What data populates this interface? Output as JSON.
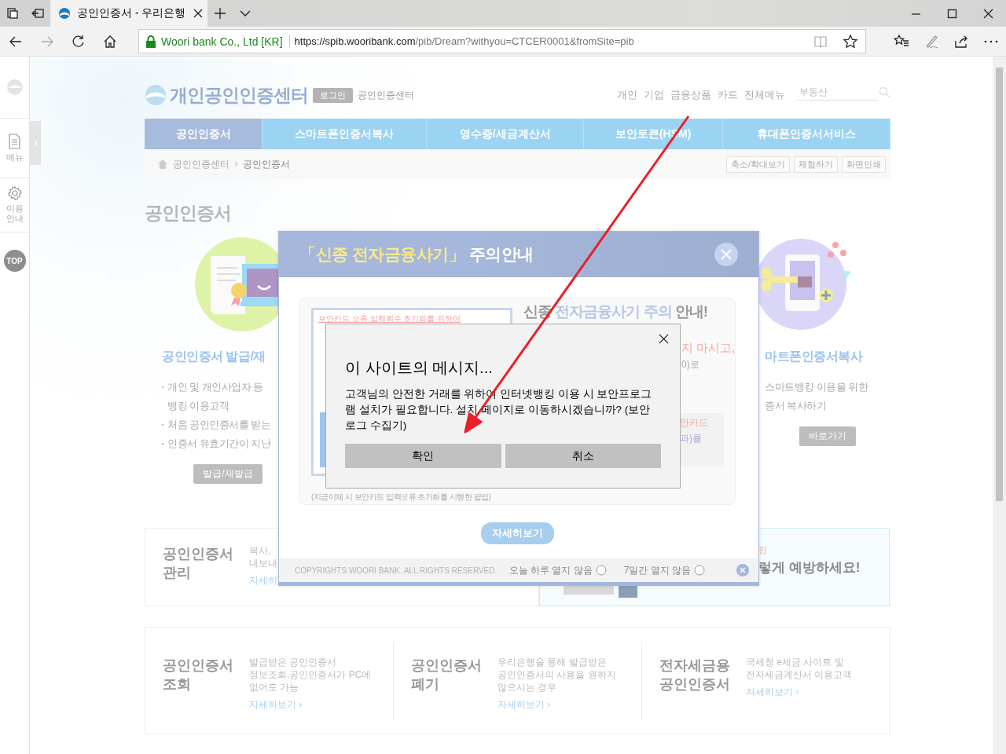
{
  "browser": {
    "tabs": [
      {
        "title": "공인인증서 - 우리은행",
        "selected": true
      }
    ],
    "site_identity": "Woori bank Co., Ltd [KR]",
    "url": {
      "host": "https://spib.wooribank.com",
      "path": "/pib/Dream?withyou=CTCER0001&fromSite=pib"
    }
  },
  "sidebar": {
    "items": [
      {
        "label": "메뉴",
        "kind": "document"
      },
      {
        "label": "이용\n안내",
        "kind": "gear"
      }
    ],
    "top_button": "TOP"
  },
  "header": {
    "logo": "개인공인인증센터",
    "login": "로그인",
    "center_link": "공인인증센터",
    "top_menu": [
      "개인",
      "기업",
      "금융상품",
      "카드",
      "전체메뉴"
    ],
    "search": {
      "placeholder": "부동산"
    }
  },
  "nav": [
    {
      "label": "공인인증서",
      "selected": true
    },
    {
      "label": "스마트폰인증서복사",
      "selected": false
    },
    {
      "label": "영수증/세금계산서",
      "selected": false
    },
    {
      "label": "보안토큰(HSM)",
      "selected": false
    },
    {
      "label": "휴대폰인증서서비스",
      "selected": false
    }
  ],
  "breadcrumb": [
    "공인인증센터",
    "공인인증서"
  ],
  "tools": [
    "축소/확대보기",
    "체험하기",
    "화면인쇄"
  ],
  "page_title": "공인인증서",
  "services": [
    {
      "kind": "certificate",
      "title": "공인인증서 발급/재",
      "bullet_marks": true,
      "bullets": [
        "개인 및 개인사업자 등\n뱅킹 이용고객",
        "처음 공인인증서를 받는",
        "인증서 유효기간이 지난"
      ],
      "button": "발급/재발급"
    },
    {
      "kind": "phone",
      "title": "마트폰인증서복사",
      "bullet_marks": false,
      "bullets": [
        "스마트뱅킹 이용을 위한\n증서 복사하기"
      ],
      "button": "바로가기"
    }
  ],
  "manage_box": {
    "title": "공인인증서\n관리",
    "desc": "복사,\n내보내",
    "link": "자세히"
  },
  "warning_box": {
    "note": "한",
    "headline": "렇게 예방하세요!"
  },
  "info_items": [
    {
      "title": "공인인증서\n조회",
      "desc": "발급받은 공인인증서\n정보조회,공인인증서가 PC에\n없어도 가능",
      "link": "자세히보기 ›"
    },
    {
      "title": "공인인증서\n폐기",
      "desc": "우리은행을 통해 발급받은\n공인인증서의 사용을 원하지\n않으시는 경우",
      "link": "자세히보기 ›"
    },
    {
      "title": "전자세금용\n공인인증서",
      "desc": "국세청 e세금 사이트 및\n전자세금계산서 이용고객",
      "link": "자세히보기 ›"
    }
  ],
  "notice_popup": {
    "title_highlight": "「신종 전자금융사기」",
    "title_rest": "주의안내",
    "card_heading": "보안카드 오류 입력회수 초기화를 위하여",
    "card_caption": "(지금이체 시 보안카드 입력오류 초기화를 시행한 팝업)",
    "headline_parts": [
      {
        "text": "신종 ",
        "kind": "plain"
      },
      {
        "text": "전자금융사기 주의",
        "kind": "accent"
      },
      {
        "text": " 안내!",
        "kind": "plain"
      }
    ],
    "fragments": [
      "지 마시고,",
      "0)로",
      "안카드",
      "과)를"
    ],
    "details_button": "자세히보기",
    "copyright": "COPYRIGHTS WOORI BANK. ALL RIGHTS RESERVED.",
    "options": [
      {
        "label": "오늘 하루 열지 않음",
        "checked": false
      },
      {
        "label": "7일간 열지 않음",
        "checked": false
      }
    ]
  },
  "alert_dialog": {
    "title": "이 사이트의 메시지...",
    "message": "고객님의 안전한 거래를 위하여 인터넷뱅킹 이용 시 보안프로그램 설치가 필요합니다. 설치 페이지로 이동하시겠습니까? (보안로그 수집기)",
    "buttons": [
      "확인",
      "취소"
    ]
  }
}
